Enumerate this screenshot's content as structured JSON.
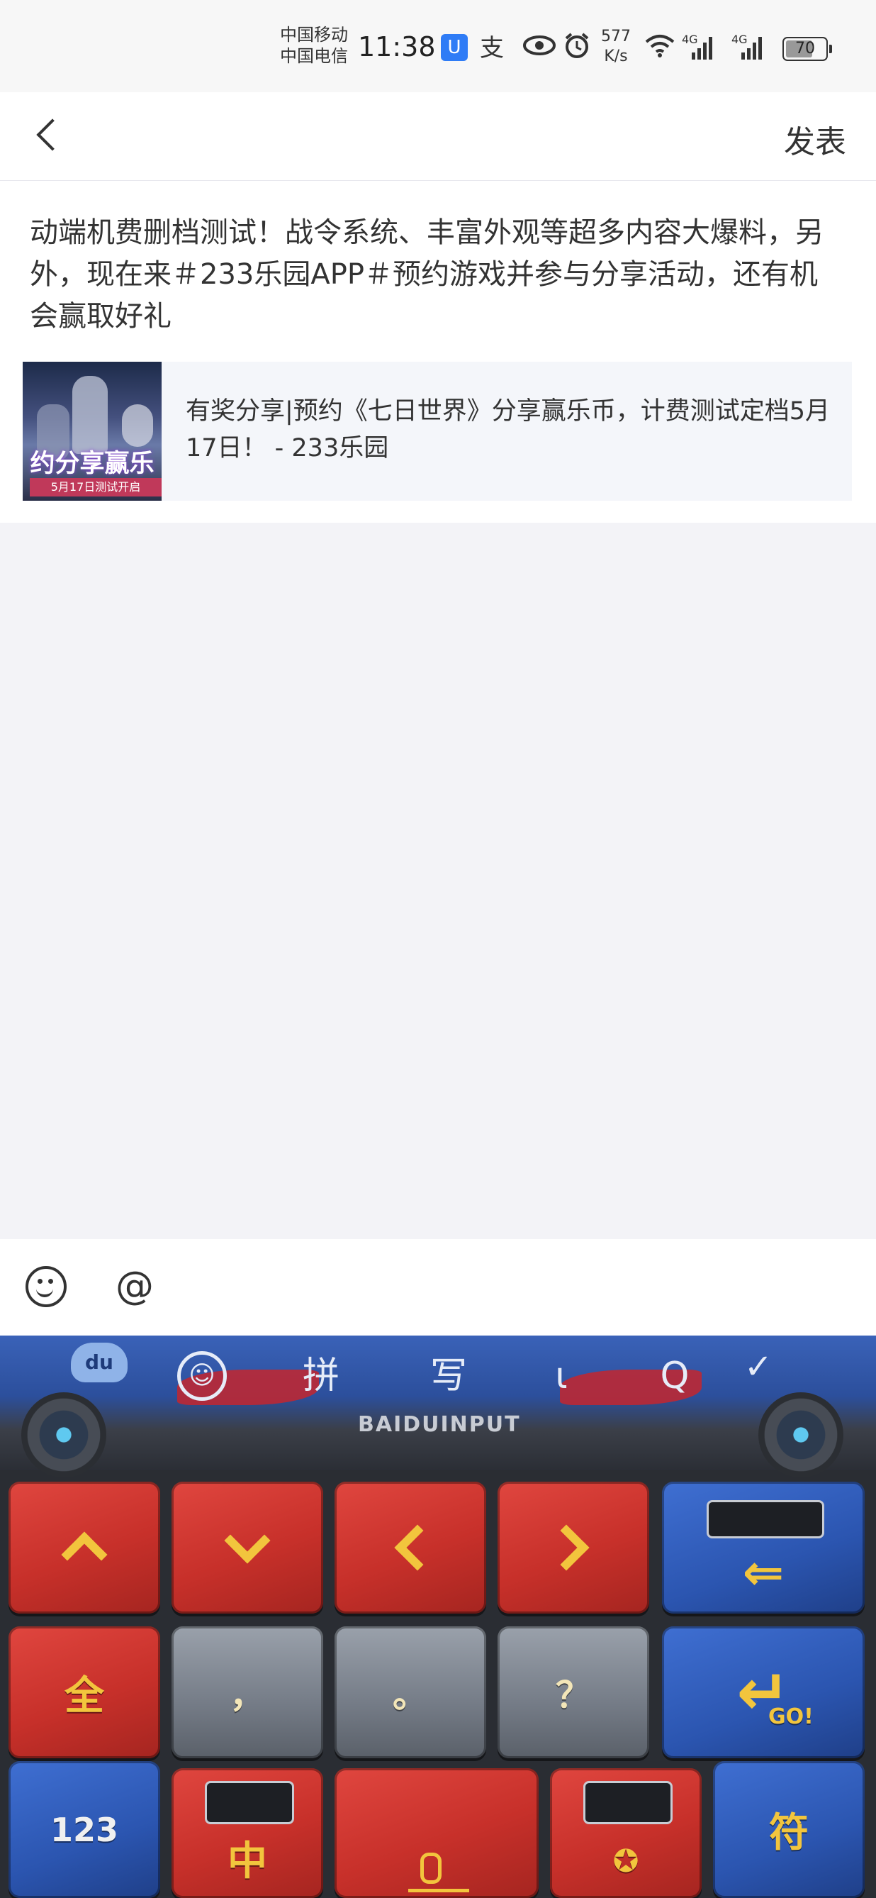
{
  "status_bar": {
    "carrier_1": "中国移动",
    "carrier_2": "中国电信",
    "time": "11:38",
    "app_badge": "U",
    "speed_value": "577",
    "speed_unit": "K/s",
    "net_1": "4G",
    "net_2": "4G",
    "battery": "70",
    "icons": [
      "app-badge-icon",
      "alipay-icon",
      "eye-icon",
      "alarm-icon",
      "wifi-icon",
      "signal-icon",
      "signal-icon",
      "battery-icon"
    ]
  },
  "header": {
    "back_icon": "chevron-left-icon",
    "publish_label": "发表"
  },
  "post": {
    "text": "动端机费删档测试！战令系统、丰富外观等超多内容大爆料，另外，现在来＃233乐园APP＃预约游戏并参与分享活动，还有机会赢取好礼",
    "share_card": {
      "thumb_banner": "约分享赢乐",
      "thumb_date": "5月17日测试开启",
      "title": "有奖分享|预约《七日世界》分享赢乐币，计费测试定档5月17日！ - 233乐园"
    }
  },
  "toolbar": {
    "emoji_icon": "emoji-icon",
    "at_label": "@"
  },
  "keyboard": {
    "logo": "du",
    "options": [
      "拼",
      "写",
      "ι",
      "Q"
    ],
    "brand": "BAIDUINPUT",
    "rows": [
      [
        "^",
        "v",
        "<",
        ">",
        "⌫"
      ],
      [
        "全",
        "，",
        "。",
        "？",
        "↵"
      ],
      [
        "123",
        "中",
        "mic",
        "autobot",
        "符"
      ]
    ],
    "enter_label": "GO!",
    "colors": {
      "red": "#c7302a",
      "blue": "#2b55b0",
      "gold": "#f2c53d"
    }
  }
}
